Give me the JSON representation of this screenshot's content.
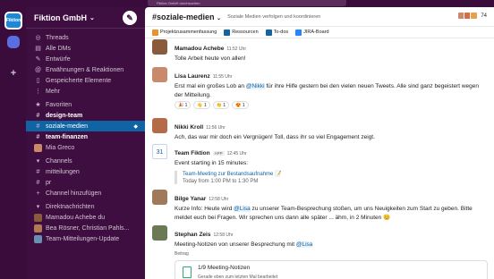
{
  "topbar": {
    "search_placeholder": "Fiktion GmbH durchsuchen"
  },
  "rail": {
    "workspace_label": "Fiktion",
    "add": "+"
  },
  "workspace": {
    "name": "Fiktion GmbH",
    "chevron": "⌄"
  },
  "nav": [
    {
      "icon": "threads-icon",
      "glyph": "◎",
      "label": "Threads"
    },
    {
      "icon": "dm-icon",
      "glyph": "▤",
      "label": "Alle DMs"
    },
    {
      "icon": "drafts-icon",
      "glyph": "✎",
      "label": "Entwürfe"
    },
    {
      "icon": "mentions-icon",
      "glyph": "@",
      "label": "Erwähnungen & Reaktionen"
    },
    {
      "icon": "saved-icon",
      "glyph": "▯",
      "label": "Gespeicherte Elemente"
    },
    {
      "icon": "more-icon",
      "glyph": "⋮",
      "label": "Mehr"
    }
  ],
  "favorites": {
    "header": "Favoriten",
    "items": [
      {
        "label": "design-team",
        "bold": true
      },
      {
        "label": "soziale-medien",
        "active": true
      },
      {
        "label": "team-finanzen",
        "bold": true
      },
      {
        "label": "Mia Greco",
        "avatar": "#c98a6b"
      }
    ]
  },
  "channels": {
    "header": "Channels",
    "items": [
      {
        "label": "mitteilungen"
      },
      {
        "label": "pr"
      }
    ],
    "add_label": "Channel hinzufügen"
  },
  "dms": {
    "header": "Direktnachrichten",
    "items": [
      {
        "label": "Mamadou Achebe du",
        "avatar": "#8a5a3c"
      },
      {
        "label": "Bea Rösner, Christian Pahls...",
        "avatar": "#b07a54"
      },
      {
        "label": "Team-Mitteilungen-Update",
        "avatar": "#6b8fb0"
      }
    ]
  },
  "channel": {
    "name": "#soziale-medien",
    "chevron": "⌄",
    "topic": "Soziale Medien verfolgen und koordinieren",
    "member_count": "74"
  },
  "bookmarks": [
    {
      "label": "Projektzusammenfassung",
      "color": "#e8912d"
    },
    {
      "label": "Ressourcen",
      "color": "#1264a3"
    },
    {
      "label": "To-dos",
      "color": "#1264a3"
    },
    {
      "label": "JIRA-Board",
      "color": "#2684ff"
    }
  ],
  "messages": [
    {
      "author": "Mamadou Achebe",
      "time": "11:52 Uhr",
      "text": "Tolle Arbeit heute von allen!"
    },
    {
      "author": "Lisa Laurenz",
      "time": "11:55 Uhr",
      "text_pre": "Erst mal ein großes Lob an ",
      "mention": "@Nikki",
      "text_post": " für ihre Hilfe gestern bei den vielen neuen Tweets. Alle sind ganz begeistert wegen der Mitteilung.",
      "reactions": [
        "🎉 1",
        "👋 1",
        "👏 1",
        "😍 1"
      ]
    },
    {
      "author": "Nikki Kroll",
      "time": "11:56 Uhr",
      "text": "Ach, das war mir doch ein Vergnügen! Toll, dass ihr so viel Engagement zeigt."
    },
    {
      "author": "Team Fiktion",
      "app": "APP",
      "time": "12:45 Uhr",
      "text": "Event starting in 15 minutes:",
      "event_title": "Team-Meeting zur Bestandsaufnahme 📝",
      "event_time": "Today from 1:00 PM to 1:30 PM",
      "cal": "31"
    },
    {
      "author": "Bilge Yanar",
      "time": "12:58 Uhr",
      "text_pre": "Kurze Info: Heute wird ",
      "mention": "@Lisa",
      "text_post": " zu unserer Team-Besprechung stoßen, um uns Neuigkeiten zum Start zu geben. Bitte meldet euch bei Fragen. Wir sprechen uns dann alle später ... ähm, in 2 Minuten 😊"
    },
    {
      "author": "Stephan Zeis",
      "time": "12:58 Uhr",
      "text_pre": "Meeting-Notizen von unserer Besprechung mit ",
      "mention": "@Lisa",
      "text_post": "",
      "sub": "Beitrag",
      "canvas_title": "1/9 Meeting-Notizen",
      "canvas_sub": "Gerade eben zum letzten Mal bearbeitet"
    }
  ]
}
